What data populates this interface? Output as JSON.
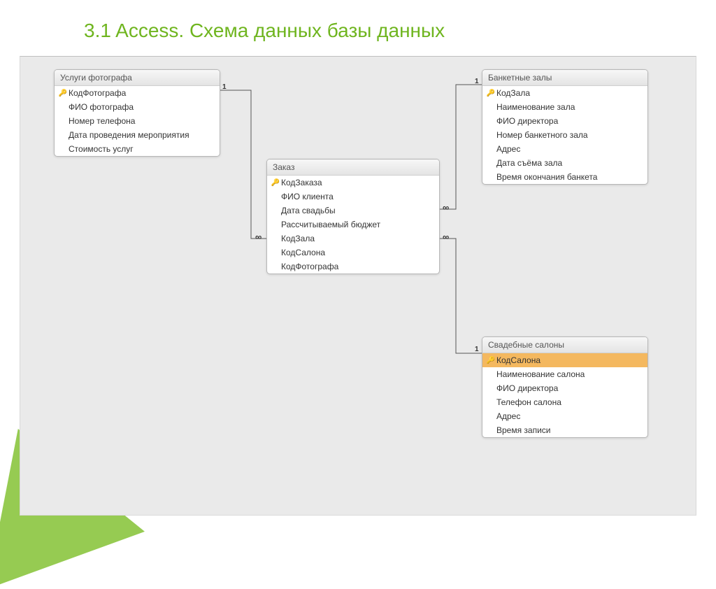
{
  "title": "3.1 Access. Схема данных базы данных",
  "tables": {
    "photographer": {
      "title": "Услуги фотографа",
      "fields": [
        {
          "name": "КодФотографа",
          "key": true
        },
        {
          "name": "ФИО фотографа",
          "key": false
        },
        {
          "name": "Номер телефона",
          "key": false
        },
        {
          "name": "Дата проведения мероприятия",
          "key": false
        },
        {
          "name": "Стоимость услуг",
          "key": false
        }
      ]
    },
    "order": {
      "title": "Заказ",
      "fields": [
        {
          "name": "КодЗаказа",
          "key": true
        },
        {
          "name": "ФИО клиента",
          "key": false
        },
        {
          "name": "Дата свадьбы",
          "key": false
        },
        {
          "name": "Рассчитываемый бюджет",
          "key": false
        },
        {
          "name": "КодЗала",
          "key": false
        },
        {
          "name": "КодСалона",
          "key": false
        },
        {
          "name": "КодФотографа",
          "key": false
        }
      ]
    },
    "halls": {
      "title": "Банкетные залы",
      "fields": [
        {
          "name": "КодЗала",
          "key": true
        },
        {
          "name": "Наименование зала",
          "key": false
        },
        {
          "name": "ФИО директора",
          "key": false
        },
        {
          "name": "Номер банкетного зала",
          "key": false
        },
        {
          "name": "Адрес",
          "key": false
        },
        {
          "name": "Дата съёма зала",
          "key": false
        },
        {
          "name": "Время окончания банкета",
          "key": false
        }
      ]
    },
    "salons": {
      "title": "Свадебные салоны",
      "fields": [
        {
          "name": "КодСалона",
          "key": true,
          "selected": true
        },
        {
          "name": "Наименование салона",
          "key": false
        },
        {
          "name": "ФИО директора",
          "key": false
        },
        {
          "name": "Телефон салона",
          "key": false
        },
        {
          "name": "Адрес",
          "key": false
        },
        {
          "name": "Время записи",
          "key": false
        }
      ]
    }
  },
  "relations": [
    {
      "from": "photographer",
      "to": "order",
      "card_from": "1",
      "card_to": "∞"
    },
    {
      "from": "halls",
      "to": "order",
      "card_from": "1",
      "card_to": "∞"
    },
    {
      "from": "salons",
      "to": "order",
      "card_from": "1",
      "card_to": "∞"
    }
  ]
}
